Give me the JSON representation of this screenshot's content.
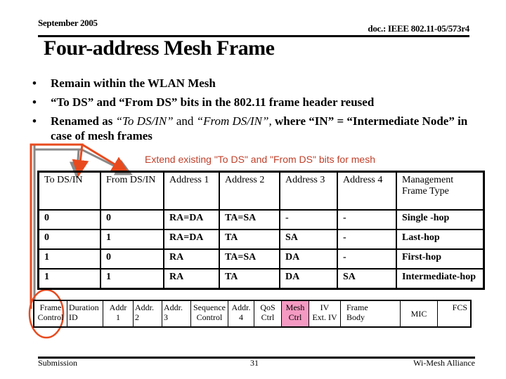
{
  "header": {
    "date": "September 2005",
    "doc_id": "doc.: IEEE 802.11-05/573r4"
  },
  "slide": {
    "title": "Four-address Mesh Frame",
    "bullets": [
      {
        "text": "Remain within the WLAN Mesh"
      },
      {
        "text": "“To DS” and “From DS” bits in the 802.11 frame header reused"
      },
      {
        "prefix": "Renamed as ",
        "italic1": "“To DS/IN”",
        "mid": " and ",
        "italic2": "“From DS/IN”,",
        "suffix": " where “IN” = “Intermediate Node” in case of mesh frames"
      }
    ],
    "callout": "Extend existing \"To DS\" and \"From DS\" bits for mesh",
    "accent_color": "#e84a1e"
  },
  "address_table": {
    "headers": [
      "To DS/IN",
      "From DS/IN",
      "Address 1",
      "Address 2",
      "Address 3",
      "Address 4",
      "Management Frame Type"
    ],
    "rows": [
      [
        "0",
        "0",
        "RA=DA",
        "TA=SA",
        "-",
        "-",
        "Single -hop"
      ],
      [
        "0",
        "1",
        "RA=DA",
        "TA",
        "SA",
        "-",
        "Last-hop"
      ],
      [
        "1",
        "0",
        "RA",
        "TA=SA",
        "DA",
        "-",
        "First-hop"
      ],
      [
        "1",
        "1",
        "RA",
        "TA",
        "DA",
        "SA",
        "Intermediate-hop"
      ]
    ]
  },
  "frame_format": {
    "fields": [
      {
        "line1": "Frame",
        "line2": "Control"
      },
      {
        "line1": "Duration",
        "line2": "ID"
      },
      {
        "line1": "Addr",
        "line2": "1"
      },
      {
        "line1": "Addr.",
        "line2": "2"
      },
      {
        "line1": "Addr.",
        "line2": "3"
      },
      {
        "line1": "Sequence",
        "line2": "Control"
      },
      {
        "line1": "Addr.",
        "line2": "4"
      },
      {
        "line1": "QoS",
        "line2": "Ctrl"
      },
      {
        "line1": "Mesh",
        "line2": "Ctrl",
        "highlight": "#f49ac2"
      },
      {
        "line1": "IV",
        "line2": "Ext. IV"
      },
      {
        "line1": "Frame",
        "line2": "Body"
      },
      {
        "line1": "MIC",
        "line2": ""
      },
      {
        "line1": "FCS",
        "line2": ""
      }
    ]
  },
  "footer": {
    "left": "Submission",
    "page": "31",
    "right": "Wi-Mesh Alliance"
  }
}
